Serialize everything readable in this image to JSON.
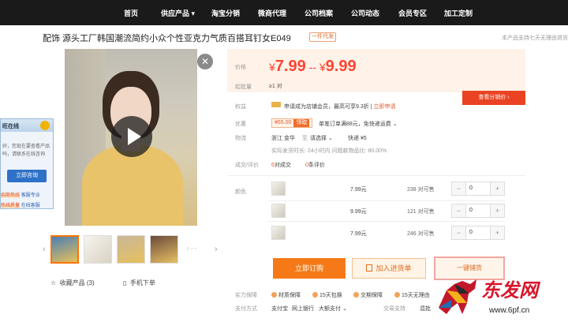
{
  "nav": {
    "items": [
      "首页",
      "供应产品",
      "淘宝分销",
      "微商代理",
      "公司档案",
      "公司动态",
      "会员专区",
      "加工定制"
    ],
    "supply_caret": "▾"
  },
  "product": {
    "title": "配饰 源头工厂韩国潮流简约小众个性亚克力气质百搭耳钉女E049",
    "dropship_badge": "一件代发",
    "return_note": "本产品支持七天无理由退货",
    "close_glyph": "✕"
  },
  "chat": {
    "title": "旺在线",
    "text": "好，您现在要查看产品吗，请联系在线咨询",
    "button": "立即咨询",
    "foot1_red": "招商热线",
    "foot1_link": "客服专业",
    "foot2_red": "热线质量",
    "foot2_link": "在线客服"
  },
  "gallery": {
    "prev": "‹",
    "next": "›",
    "more": "○ - -",
    "favorite_label": "收藏产品",
    "favorite_count": "(3)",
    "mobile_order": "手机下单"
  },
  "price": {
    "label": "价格",
    "currency": "¥",
    "low": "7.99",
    "separator": "--",
    "high": "9.99",
    "moq_label": "起批量",
    "moq": "≥1 对"
  },
  "benefits": {
    "label": "权益",
    "text": "申请成为店铺会员，最高可享9.3折",
    "apply": "立即申请"
  },
  "discount": {
    "label": "优惠",
    "coupon_amount": "¥65.00",
    "coupon_tag": "领取",
    "text": "单笔订单满88元，免快递运费",
    "caret": "⌄"
  },
  "logistics": {
    "label": "物流",
    "origin": "浙江 金华",
    "to_label": "至",
    "destination": "请选择",
    "caret": "⌄",
    "shipping": "快递 ¥5",
    "stats": "实际发货时长: 24小时内  问题款物品比: 80.00%"
  },
  "reviews": {
    "label": "成交/评价",
    "deals_count": "6",
    "deals_text": "对成交",
    "reviews_count": "0",
    "reviews_text": "条评价"
  },
  "distributor_price_button": "查看分销价 ›",
  "variants": {
    "label": "颜色",
    "rows": [
      {
        "price": "7.99元",
        "stock": "238 对可售",
        "qty": "0"
      },
      {
        "price": "9.99元",
        "stock": "121 对可售",
        "qty": "0"
      },
      {
        "price": "7.99元",
        "stock": "246 对可售",
        "qty": "0"
      }
    ],
    "minus": "−",
    "plus": "+"
  },
  "actions": {
    "order": "立即订购",
    "purchase_list": "加入进货单",
    "one_click": "一键铺货"
  },
  "guarantees": {
    "label": "实力保障",
    "items": [
      "材质保障",
      "15天包换",
      "交期保障",
      "15天无理由"
    ]
  },
  "payment": {
    "label": "支付方式",
    "methods": [
      "支付宝",
      "网上银行",
      "大额支付"
    ],
    "caret": "⌄",
    "trade_label": "交易支持",
    "trade_value": "混批"
  },
  "watermark": {
    "text": "东发网",
    "url": "www.6pf.cn"
  }
}
